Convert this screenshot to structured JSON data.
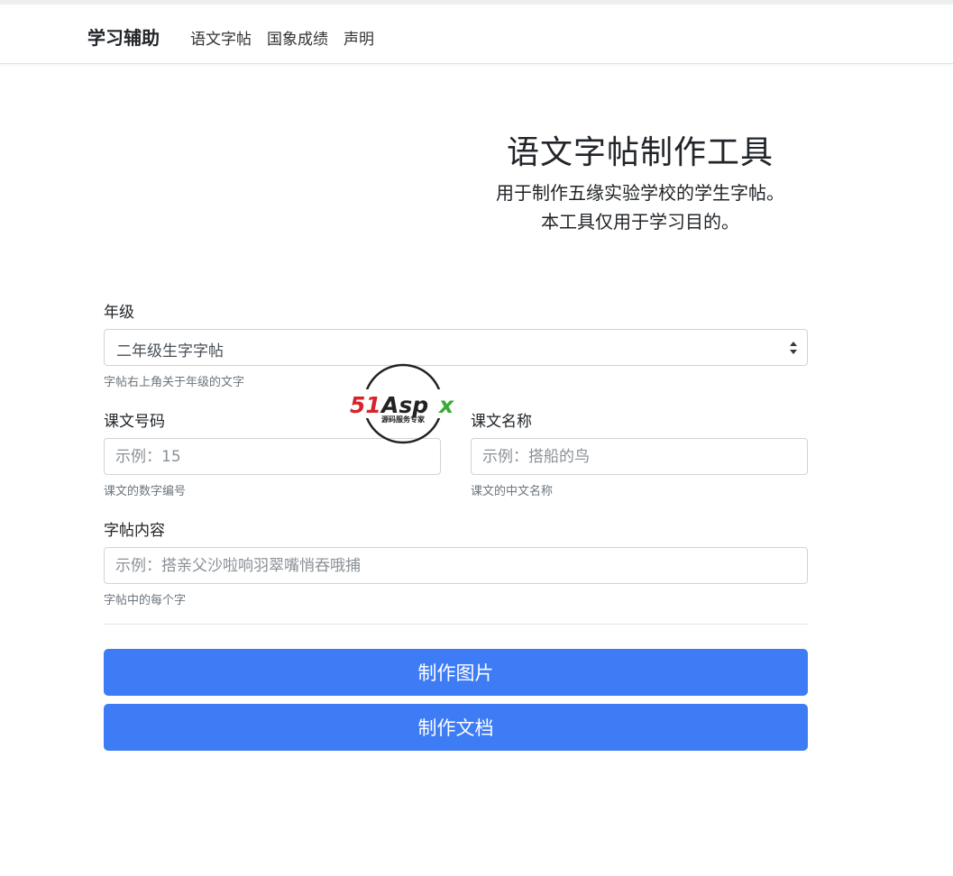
{
  "navbar": {
    "brand": "学习辅助",
    "links": [
      "语文字帖",
      "国象成绩",
      "声明"
    ]
  },
  "hero": {
    "title": "语文字帖制作工具",
    "lines": [
      "用于制作五缘实验学校的学生字帖。",
      "本工具仅用于学习目的。"
    ]
  },
  "form": {
    "grade": {
      "label": "年级",
      "value": "二年级生字字帖",
      "help": "字帖右上角关于年级的文字"
    },
    "lesson_number": {
      "label": "课文号码",
      "placeholder": "示例：15",
      "help": "课文的数字编号"
    },
    "lesson_name": {
      "label": "课文名称",
      "placeholder": "示例：搭船的鸟",
      "help": "课文的中文名称"
    },
    "content": {
      "label": "字帖内容",
      "placeholder": "示例：搭亲父沙啦响羽翠嘴悄吞哦捕",
      "help": "字帖中的每个字"
    }
  },
  "buttons": {
    "make_image": "制作图片",
    "make_doc": "制作文档"
  },
  "watermark": {
    "brand": "51Aspx",
    "tagline": "源码服务专家"
  },
  "colors": {
    "primary": "#3d7cf5",
    "watermark_red": "#d8232a",
    "watermark_green": "#3aaa35"
  }
}
